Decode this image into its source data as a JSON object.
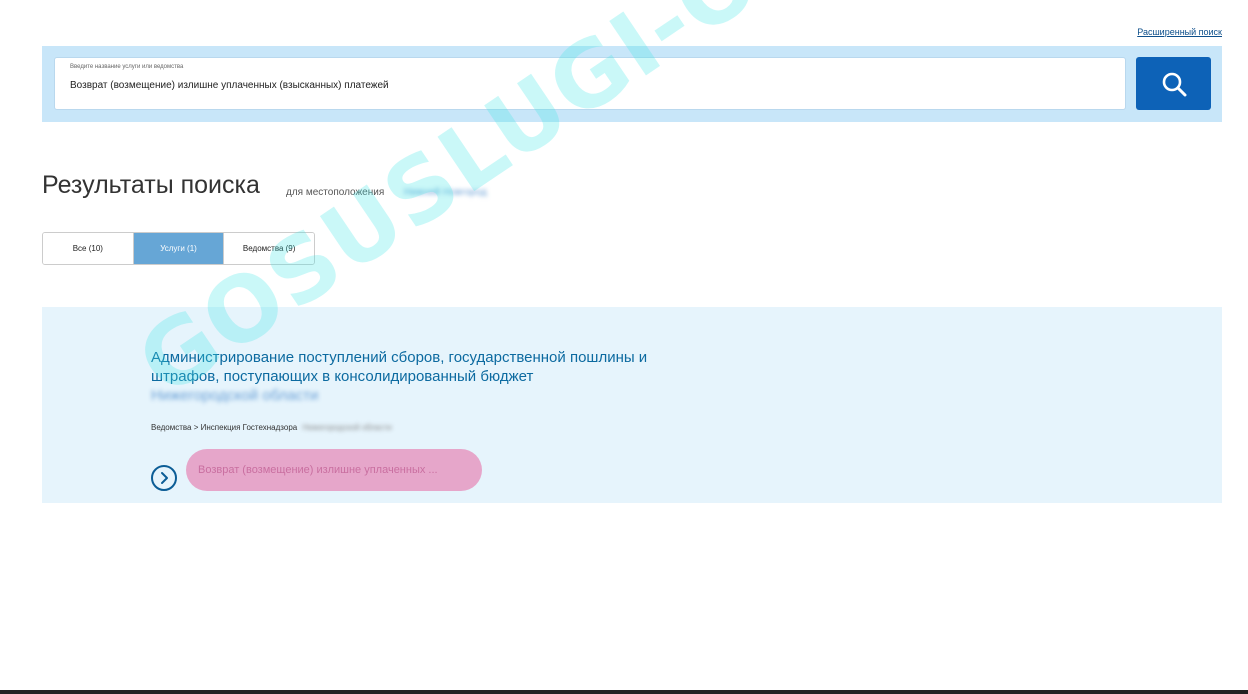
{
  "header": {
    "advanced_search": "Расширенный поиск"
  },
  "search": {
    "placeholder": "Введите название услуги или ведомства",
    "value": "Возврат (возмещение) излишне уплаченных (взысканных) платежей",
    "button_icon": "search-icon"
  },
  "results": {
    "title": "Результаты поиска",
    "subtitle": "для местоположения",
    "location": "Нижний Новгород"
  },
  "tabs": [
    {
      "label": "Все (10)",
      "active": false
    },
    {
      "label": "Услуги (1)",
      "active": true
    },
    {
      "label": "Ведомства (9)",
      "active": false
    }
  ],
  "result_card": {
    "title": "Администрирование поступлений сборов, государственной пошлины и штрафов, поступающих в консолидированный бюджет",
    "title_blurred": "Нижегородской области",
    "breadcrumb": "Ведомства > Инспекция Гостехнадзора",
    "breadcrumb_blurred": "Нижегородской области",
    "service_link": "Возврат (возмещение) излишне уплаченных ...",
    "go_icon": "chevron-right-circle-icon"
  },
  "watermark": "GOSUSLUGI-ONLINE.RU",
  "colors": {
    "accent": "#0d62b7",
    "band": "#c8e6f9",
    "tab_active": "#66a6d6",
    "card_bg": "#e6f4fc",
    "link": "#0c6aa0"
  }
}
